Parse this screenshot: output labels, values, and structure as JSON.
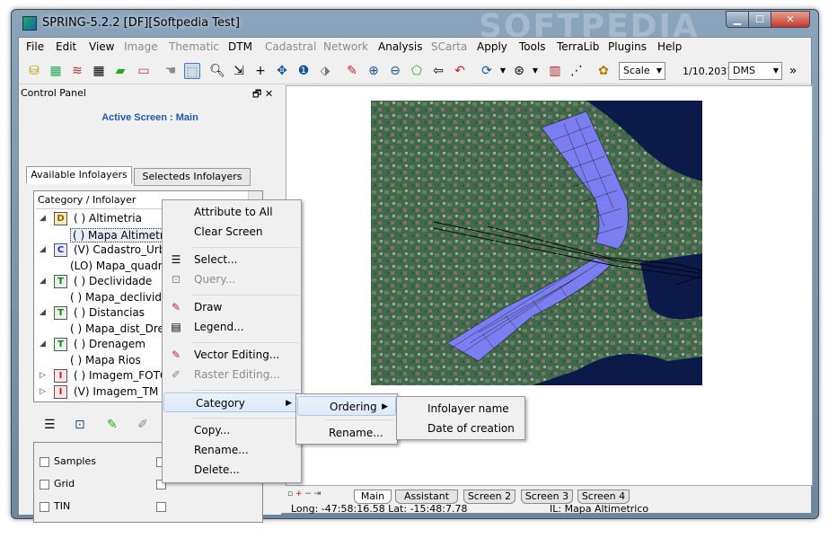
{
  "window": {
    "title": "SPRING-5.2.2 [DF][Softpedia Test]",
    "watermark": "SOFTPEDIA"
  },
  "menubar": {
    "items": [
      {
        "label": "File",
        "enabled": true
      },
      {
        "label": "Edit",
        "enabled": true
      },
      {
        "label": "View",
        "enabled": true
      },
      {
        "label": "Image",
        "enabled": false
      },
      {
        "label": "Thematic",
        "enabled": false
      },
      {
        "label": "DTM",
        "enabled": true
      },
      {
        "label": "Cadastral",
        "enabled": false
      },
      {
        "label": "Network",
        "enabled": false
      },
      {
        "label": "Analysis",
        "enabled": true
      },
      {
        "label": "SCarta",
        "enabled": false
      },
      {
        "label": "Apply",
        "enabled": true
      },
      {
        "label": "Tools",
        "enabled": true
      },
      {
        "label": "TerraLib",
        "enabled": true
      },
      {
        "label": "Plugins",
        "enabled": true
      },
      {
        "label": "Help",
        "enabled": true
      }
    ]
  },
  "toolbar": {
    "scale_mode": "Scale",
    "scale_value": "1/10.203125",
    "coord_format": "DMS",
    "more": "»"
  },
  "control_panel": {
    "title": "Control Panel",
    "active_screen": "Active Screen : Main",
    "tabs": [
      "Available Infolayers",
      "Selecteds Infolayers"
    ],
    "tree_header": "Category / Infolayer",
    "tree": [
      {
        "text": "( ) Altimetria",
        "cat": "D"
      },
      {
        "text": "( ) Mapa Altimetrico",
        "child": true,
        "selected": true
      },
      {
        "text": "(V) Cadastro_Urbano",
        "cat": "C"
      },
      {
        "text": "(LO) Mapa_quadras",
        "child": true
      },
      {
        "text": "( ) Declividade",
        "cat": "T"
      },
      {
        "text": "( ) Mapa_declividade",
        "child": true
      },
      {
        "text": "( ) Distancias",
        "cat": "T"
      },
      {
        "text": "( ) Mapa_dist_Drenagem",
        "child": true
      },
      {
        "text": "( ) Drenagem",
        "cat": "T"
      },
      {
        "text": "( ) Mapa Rios",
        "child": true
      },
      {
        "text": "( ) Imagem_FOTO",
        "cat": "I"
      },
      {
        "text": "(V) Imagem_TM",
        "cat": "I"
      }
    ],
    "checkboxes": [
      "Samples",
      "Grid",
      "TIN"
    ]
  },
  "context_menu": {
    "items": [
      {
        "label": "Attribute to All",
        "enabled": true
      },
      {
        "label": "Clear Screen",
        "enabled": true
      },
      {
        "label": "Select...",
        "enabled": true
      },
      {
        "label": "Query...",
        "enabled": false
      },
      {
        "label": "Draw",
        "enabled": true
      },
      {
        "label": "Legend...",
        "enabled": true
      },
      {
        "label": "Vector Editing...",
        "enabled": true
      },
      {
        "label": "Raster Editing...",
        "enabled": false
      },
      {
        "label": "Category",
        "enabled": true
      },
      {
        "label": "Copy...",
        "enabled": true
      },
      {
        "label": "Rename...",
        "enabled": true
      },
      {
        "label": "Delete...",
        "enabled": true
      }
    ]
  },
  "submenu_category": {
    "items": [
      "Ordering",
      "Rename..."
    ]
  },
  "submenu_ordering": {
    "items": [
      "Infolayer name",
      "Date of creation"
    ]
  },
  "screen_tabs": [
    "Main",
    "Assistant",
    "Screen 2",
    "Screen 3",
    "Screen 4"
  ],
  "status": {
    "coords": "Long: -47:58:16.58 Lat: -15:48:7.78",
    "infolayer": "IL: Mapa Altimetrico"
  },
  "colors": {
    "accent": "#1e5aa8",
    "polygon_fill": "#7b7ef0",
    "map_water": "#0c1a4a"
  }
}
